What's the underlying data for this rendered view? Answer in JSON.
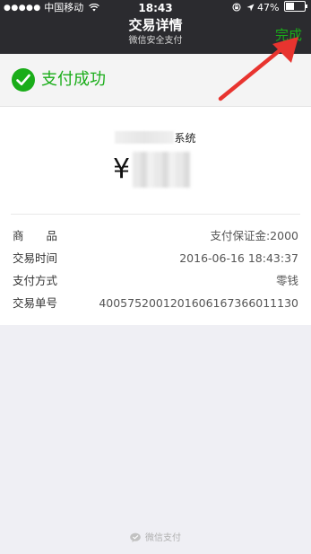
{
  "status_bar": {
    "signal_dots": "●●●●●",
    "carrier": "中国移动",
    "time": "18:43",
    "battery": "47%",
    "battery_level": 0.47
  },
  "nav": {
    "title": "交易详情",
    "subtitle": "微信安全支付",
    "done_label": "完成"
  },
  "success": {
    "text": "支付成功"
  },
  "receipt": {
    "merchant_suffix": "系统",
    "currency": "¥"
  },
  "details": [
    {
      "label": "商　　品",
      "value": "支付保证金:2000"
    },
    {
      "label": "交易时间",
      "value": "2016-06-16 18:43:37"
    },
    {
      "label": "支付方式",
      "value": "零钱"
    },
    {
      "label": "交易单号",
      "value": "4005752001201606167366011130"
    }
  ],
  "footer": {
    "text": "微信支付"
  },
  "colors": {
    "accent": "#1aad19",
    "annotation_arrow": "#e8342f"
  },
  "icons": [
    "wifi-icon",
    "lock-rotation-icon",
    "location-arrow-icon",
    "battery-icon",
    "checkmark-icon",
    "wechat-pay-icon"
  ]
}
